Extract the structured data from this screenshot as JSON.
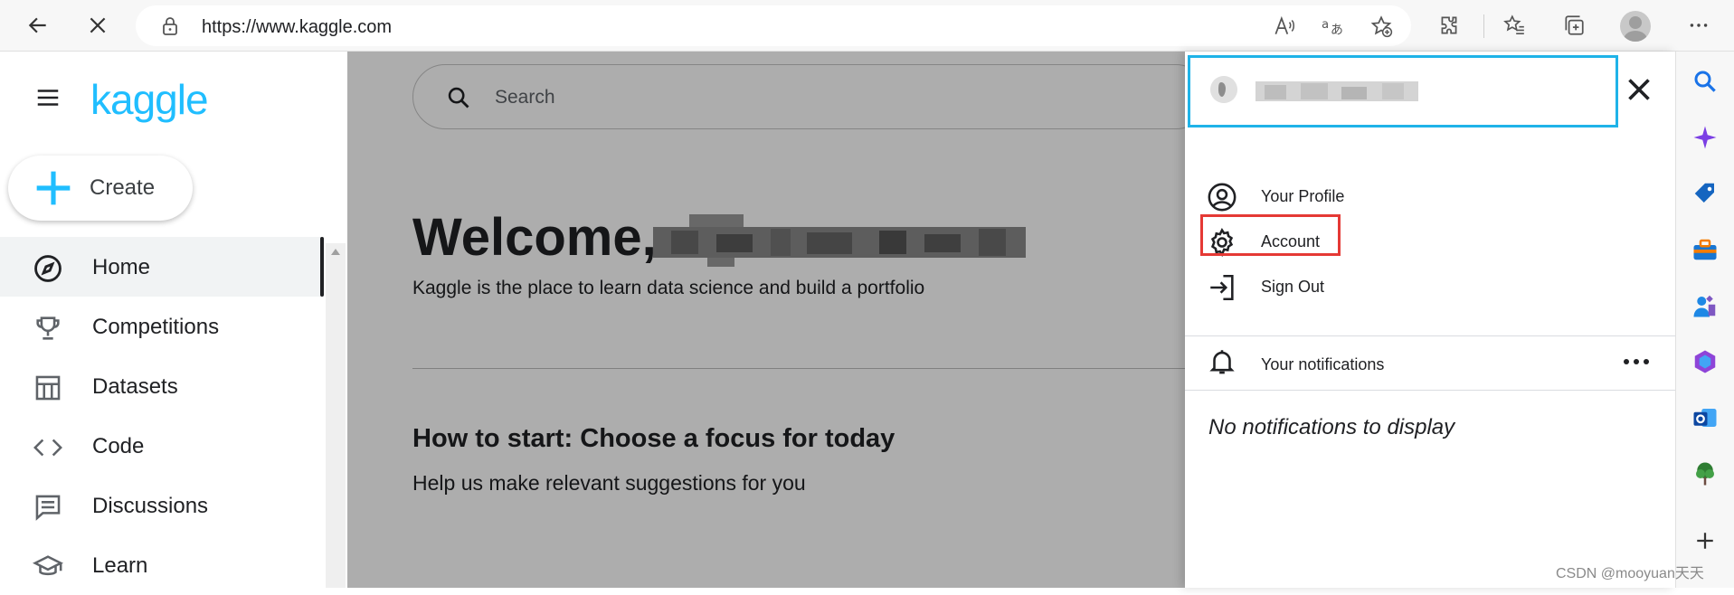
{
  "browser": {
    "url": "https://www.kaggle.com"
  },
  "sidebar": {
    "logo": "kaggle",
    "create_label": "Create",
    "items": [
      {
        "label": "Home",
        "icon": "compass-icon",
        "active": true
      },
      {
        "label": "Competitions",
        "icon": "trophy-icon"
      },
      {
        "label": "Datasets",
        "icon": "table-icon"
      },
      {
        "label": "Code",
        "icon": "code-icon"
      },
      {
        "label": "Discussions",
        "icon": "comments-icon"
      },
      {
        "label": "Learn",
        "icon": "graduation-cap-icon"
      }
    ]
  },
  "main": {
    "search_placeholder": "Search",
    "welcome": "Welcome,",
    "tagline": "Kaggle is the place to learn data science and build a portfolio",
    "howto_title": "How to start: Choose a focus for today",
    "howto_sub": "Help us make relevant suggestions for you"
  },
  "profile_panel": {
    "menu": [
      {
        "label": "Your Profile",
        "icon": "user-circle-icon"
      },
      {
        "label": "Account",
        "icon": "gear-icon"
      },
      {
        "label": "Sign Out",
        "icon": "sign-out-icon"
      }
    ],
    "notifications_label": "Your notifications",
    "no_notifications": "No notifications to display"
  },
  "colors": {
    "kaggle_blue": "#20beff",
    "highlight_red": "#e53935",
    "header_border": "#1fb3e8"
  },
  "watermark": "CSDN @mooyuan天天"
}
